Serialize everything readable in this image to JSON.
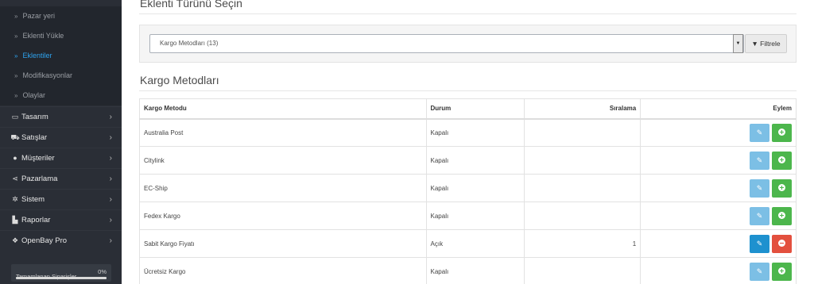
{
  "sidebar": {
    "sub_items": [
      {
        "label": "Pazar yeri",
        "active": false
      },
      {
        "label": "Eklenti Yükle",
        "active": false
      },
      {
        "label": "Eklentiler",
        "active": true
      },
      {
        "label": "Modifikasyonlar",
        "active": false
      },
      {
        "label": "Olaylar",
        "active": false
      }
    ],
    "main_items": [
      {
        "label": "Tasarım",
        "icon": "monitor-icon"
      },
      {
        "label": "Satışlar",
        "icon": "cart-icon"
      },
      {
        "label": "Müşteriler",
        "icon": "user-icon"
      },
      {
        "label": "Pazarlama",
        "icon": "share-icon"
      },
      {
        "label": "Sistem",
        "icon": "cog-icon"
      },
      {
        "label": "Raporlar",
        "icon": "bar-chart-icon"
      },
      {
        "label": "OpenBay Pro",
        "icon": "cubes-icon"
      }
    ],
    "progress": {
      "label": "Tamamlanan Siparişler",
      "percent_text": "0%",
      "percent": 0
    }
  },
  "main": {
    "section_title": "Eklenti Türünü Seçin",
    "filter": {
      "selected": "Kargo Metodları (13)",
      "button_label": "Filtrele"
    },
    "list_title": "Kargo Metodları",
    "table": {
      "headers": {
        "method": "Kargo Metodu",
        "status": "Durum",
        "sort": "Sıralama",
        "action": "Eylem"
      },
      "rows": [
        {
          "name": "Australia Post",
          "status": "Kapalı",
          "sort": "",
          "installed": false
        },
        {
          "name": "Citylink",
          "status": "Kapalı",
          "sort": "",
          "installed": false
        },
        {
          "name": "EC-Ship",
          "status": "Kapalı",
          "sort": "",
          "installed": false
        },
        {
          "name": "Fedex Kargo",
          "status": "Kapalı",
          "sort": "",
          "installed": false
        },
        {
          "name": "Sabit Kargo Fiyatı",
          "status": "Açık",
          "sort": "1",
          "installed": true
        },
        {
          "name": "Ücretsiz Kargo",
          "status": "Kapalı",
          "sort": "",
          "installed": false
        }
      ]
    }
  },
  "colors": {
    "sidebar_bg": "#2a2e36",
    "active_link": "#2ea3ee",
    "edit_button": "#7cbfe5",
    "install_button": "#4cb64c",
    "uninstall_button": "#e3503e"
  }
}
